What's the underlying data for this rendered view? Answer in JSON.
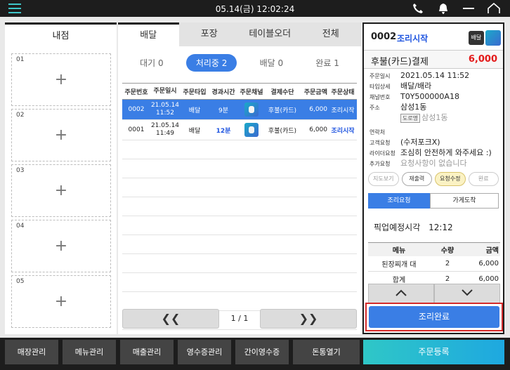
{
  "topbar": {
    "datetime": "05.14(금) 12:02:24"
  },
  "left": {
    "title": "내점",
    "tables": [
      "01",
      "02",
      "03",
      "04",
      "05"
    ]
  },
  "center": {
    "tabs": [
      "배달",
      "포장",
      "테이블오더",
      "전체"
    ],
    "statuses": [
      "대기 0",
      "처리중 2",
      "배달 0",
      "완료 1"
    ],
    "columns": [
      "주문번호",
      "주문일시",
      "주문타입",
      "경과시간",
      "주문채널",
      "결제수단",
      "주문금액",
      "주문상태"
    ],
    "rows": [
      {
        "no": "0002",
        "date": "21.05.14",
        "time": "11:52",
        "type": "배달",
        "elapsed": "9분",
        "pay": "후불(카드)",
        "amount": "6,000",
        "status": "조리시작"
      },
      {
        "no": "0001",
        "date": "21.05.14",
        "time": "11:49",
        "type": "배달",
        "elapsed": "12분",
        "pay": "후불(카드)",
        "amount": "6,000",
        "status": "조리시작"
      }
    ],
    "pager": {
      "prev": "❮❮",
      "info": "1 / 1",
      "next": "❯❯"
    }
  },
  "detail": {
    "order_no": "0002",
    "order_status": "조리시작",
    "type_badge": "배달",
    "pay_method": "후불(카드)결제",
    "pay_amount": "6,000",
    "fields": {
      "order_time_label": "주문일시",
      "order_time": "2021.05.14 11:52",
      "type_label": "타입상세",
      "type": "배달/배라",
      "channel_label": "채널번호",
      "channel": "T0Y500000A18",
      "addr_label": "주소",
      "addr": "삼성1동",
      "road_label": "도로명",
      "road_addr": "삼성1동",
      "phone_label": "연락처",
      "cust_label": "고객요청",
      "cust": "(수저포크X)",
      "rider_label": "라이더요청",
      "rider": "조심히 안전하게 와주세요 :)",
      "extra_label": "추가요청",
      "extra": "요청사항이 없습니다"
    },
    "pills": [
      "지도보기",
      "재출력",
      "요청수정",
      "완료"
    ],
    "steps": [
      "조리요청",
      "가게도착"
    ],
    "pickup_label": "픽업예정시각",
    "pickup_time": "12:12",
    "menu_cols": [
      "메뉴",
      "수량",
      "금액"
    ],
    "menu_rows": [
      {
        "name": "된장찌개 대",
        "qty": "2",
        "price": "6,000"
      },
      {
        "name": "합계",
        "qty": "2",
        "price": "6,000"
      }
    ],
    "done_label": "조리완료"
  },
  "bottom": {
    "buttons": [
      "매장관리",
      "메뉴관리",
      "매출관리",
      "영수증관리",
      "간이영수증",
      "돈통열기"
    ],
    "register": "주문등록"
  }
}
